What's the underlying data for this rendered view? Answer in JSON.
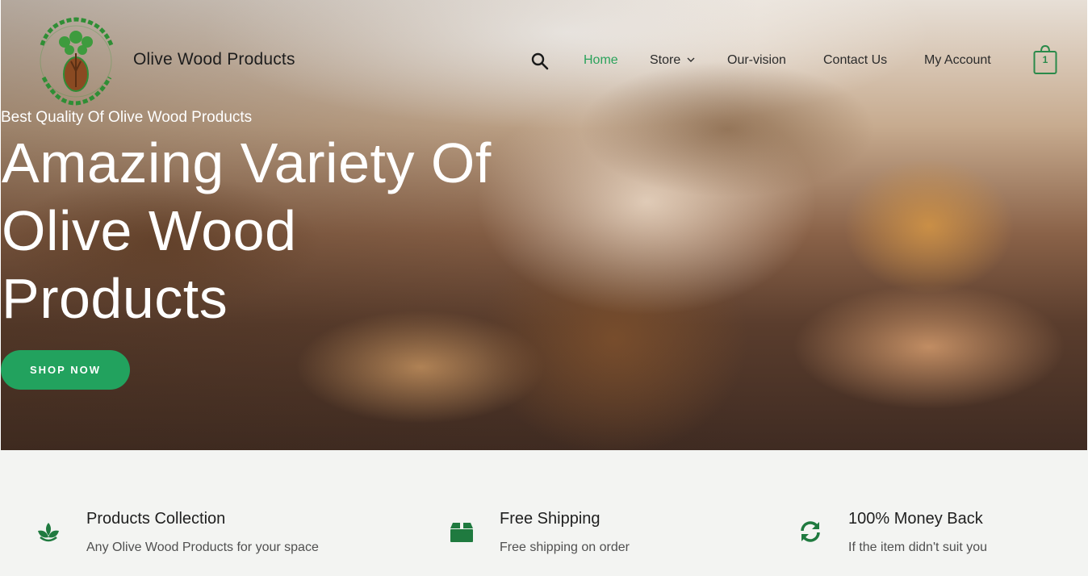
{
  "header": {
    "site_title": "Olive Wood Products",
    "logo": {
      "icon": "olive-tree-logo",
      "lettering": "OLIVE WOOD PRODUCTS"
    },
    "search_icon": "search-icon",
    "nav": [
      {
        "label": "Home",
        "active": true
      },
      {
        "label": "Store",
        "has_dropdown": true
      },
      {
        "label": "Our-vision"
      },
      {
        "label": "Contact Us"
      },
      {
        "label": "My Account"
      }
    ],
    "cart": {
      "icon": "shopping-bag-icon",
      "count": "1"
    }
  },
  "hero": {
    "tagline": "Best Quality Of Olive Wood Products",
    "headline": "Amazing Variety Of Olive Wood Products",
    "button_label": "SHOP NOW"
  },
  "features": [
    {
      "icon": "leaf-icon",
      "title": "Products Collection",
      "text": "Any Olive Wood Products for your space"
    },
    {
      "icon": "box-icon",
      "title": "Free Shipping",
      "text": "Free shipping on order"
    },
    {
      "icon": "refresh-icon",
      "title": "100% Money Back",
      "text": "If the item didn't suit you"
    }
  ],
  "colors": {
    "accent": "#22a25e",
    "nav_active": "#2aa25b",
    "icon_green": "#1f7a3f",
    "features_bg": "#f3f4f2"
  }
}
